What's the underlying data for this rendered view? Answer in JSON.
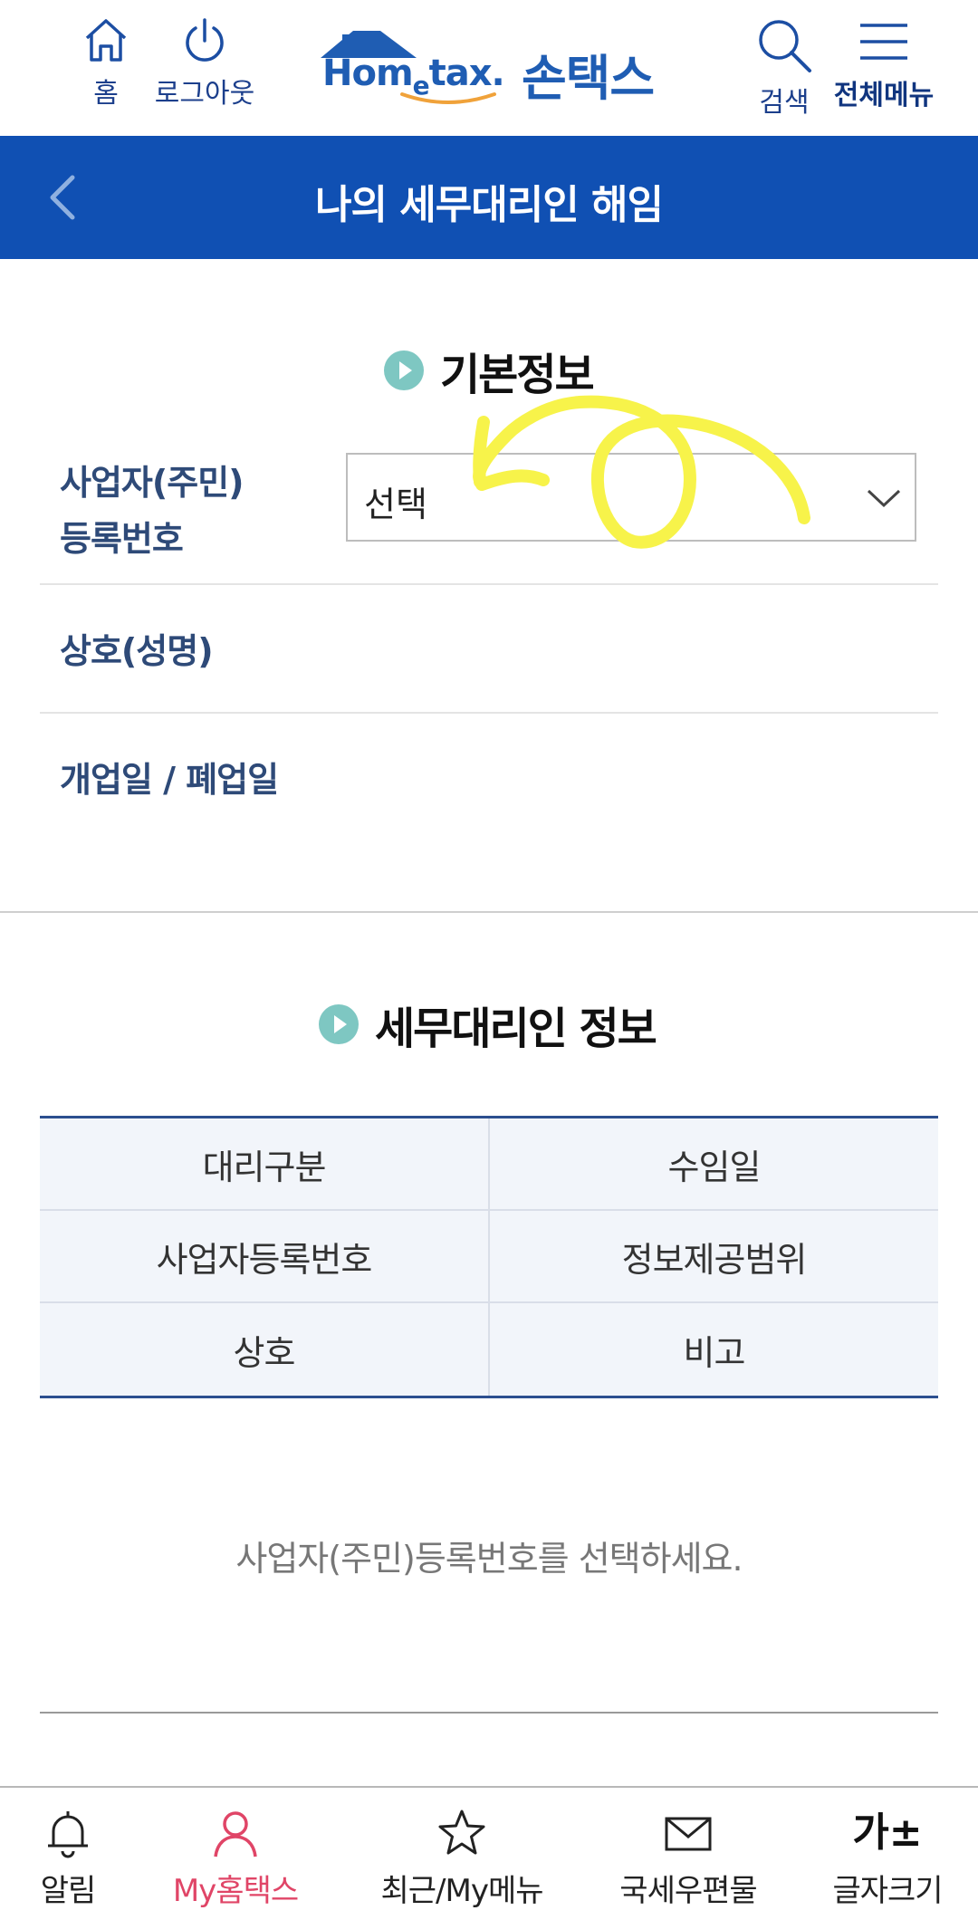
{
  "header": {
    "home_label": "홈",
    "logout_label": "로그아웃",
    "logo_en": "Hom",
    "logo_e": "e",
    "logo_en_tail": "tax.",
    "logo_ko": "손택스",
    "search_label": "검색",
    "menu_label": "전체메뉴"
  },
  "titlebar": {
    "title": "나의 세무대리인 해임"
  },
  "basic_info": {
    "heading": "기본정보",
    "reg_no_label_line1": "사업자(주민)",
    "reg_no_label_line2": "등록번호",
    "reg_no_select_value": "선택",
    "name_label": "상호(성명)",
    "dates_label": "개업일 / 폐업일"
  },
  "agent_info": {
    "heading": "세무대리인 정보",
    "table": [
      [
        "대리구분",
        "수임일"
      ],
      [
        "사업자등록번호",
        "정보제공범위"
      ],
      [
        "상호",
        "비고"
      ]
    ],
    "empty_message": "사업자(주민)등록번호를 선택하세요."
  },
  "bottom_nav": {
    "items": [
      {
        "label": "알림",
        "icon": "bell-icon"
      },
      {
        "label": "My홈택스",
        "icon": "person-icon"
      },
      {
        "label": "최근/My메뉴",
        "icon": "star-icon"
      },
      {
        "label": "국세우편물",
        "icon": "mail-icon"
      },
      {
        "label": "글자크기",
        "icon": "font-size-icon",
        "glyph": "가±"
      }
    ]
  },
  "colors": {
    "brand_blue": "#1050b3",
    "accent_teal": "#7ec7c2",
    "active_pink": "#e04567",
    "annotation_yellow": "#f7f34a"
  }
}
